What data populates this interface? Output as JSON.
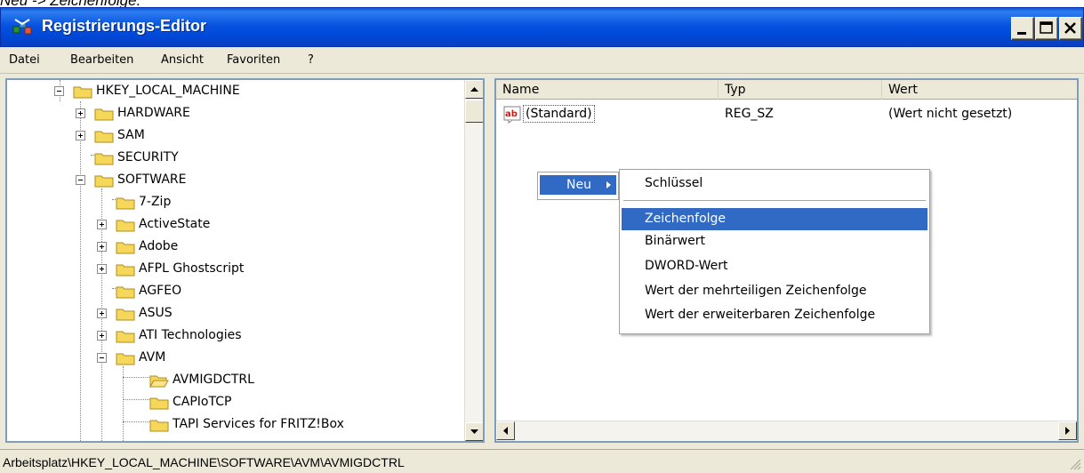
{
  "caption": "Neu -> Zeichenfolge.",
  "window": {
    "title": "Registrierungs-Editor",
    "icon": "regedit-icon",
    "controls": {
      "minimize": "minimize-icon",
      "maximize": "maximize-icon",
      "close": "close-icon"
    }
  },
  "menu": {
    "items": [
      "Datei",
      "Bearbeiten",
      "Ansicht",
      "Favoriten",
      "?"
    ]
  },
  "tree": {
    "items": [
      {
        "label": "HKEY_LOCAL_MACHINE",
        "level": 0,
        "expander": "minus"
      },
      {
        "label": "HARDWARE",
        "level": 1,
        "expander": "plus"
      },
      {
        "label": "SAM",
        "level": 1,
        "expander": "plus"
      },
      {
        "label": "SECURITY",
        "level": 1,
        "expander": "none"
      },
      {
        "label": "SOFTWARE",
        "level": 1,
        "expander": "minus"
      },
      {
        "label": "7-Zip",
        "level": 2,
        "expander": "none"
      },
      {
        "label": "ActiveState",
        "level": 2,
        "expander": "plus"
      },
      {
        "label": "Adobe",
        "level": 2,
        "expander": "plus"
      },
      {
        "label": "AFPL Ghostscript",
        "level": 2,
        "expander": "plus"
      },
      {
        "label": "AGFEO",
        "level": 2,
        "expander": "none"
      },
      {
        "label": "ASUS",
        "level": 2,
        "expander": "plus"
      },
      {
        "label": "ATI Technologies",
        "level": 2,
        "expander": "plus"
      },
      {
        "label": "AVM",
        "level": 2,
        "expander": "minus"
      },
      {
        "label": "AVMIGDCTRL",
        "level": 3,
        "expander": "none",
        "open": true
      },
      {
        "label": "CAPIoTCP",
        "level": 3,
        "expander": "none"
      },
      {
        "label": "TAPI Services for FRITZ!Box",
        "level": 3,
        "expander": "none"
      }
    ]
  },
  "list": {
    "columns": [
      "Name",
      "Typ",
      "Wert"
    ],
    "rows": [
      {
        "icon": "string-value-icon",
        "name": "(Standard)",
        "type": "REG_SZ",
        "value": "(Wert nicht gesetzt)"
      }
    ]
  },
  "context_menu": {
    "parent_label": "Neu",
    "submenu": [
      "Schlüssel",
      "Zeichenfolge",
      "Binärwert",
      "DWORD-Wert",
      "Wert der mehrteiligen Zeichenfolge",
      "Wert der erweiterbaren Zeichenfolge"
    ],
    "selected": "Zeichenfolge"
  },
  "status": "Arbeitsplatz\\HKEY_LOCAL_MACHINE\\SOFTWARE\\AVM\\AVMIGDCTRL",
  "colors": {
    "title_bar": "#0453e0",
    "selection": "#316ac5",
    "window_face": "#ece9d8",
    "folder": "#f5d75a"
  }
}
